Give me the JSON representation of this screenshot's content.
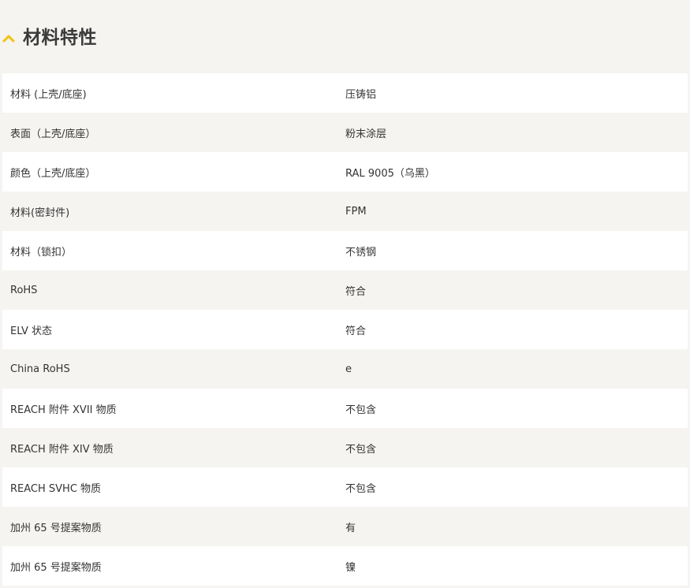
{
  "section": {
    "title": "材料特性",
    "toggle_icon": "chevron-up-icon",
    "accent_color": "#f2c51e"
  },
  "rows": [
    {
      "label": "材料 (上壳/底座)",
      "value": "压铸铝"
    },
    {
      "label": "表面（上壳/底座）",
      "value": "粉末涂层"
    },
    {
      "label": "颜色（上壳/底座）",
      "value": "RAL 9005（乌黑）"
    },
    {
      "label": "材料(密封件)",
      "value": "FPM"
    },
    {
      "label": "材料（锁扣）",
      "value": "不锈钢"
    },
    {
      "label": "RoHS",
      "value": "符合"
    },
    {
      "label": "ELV 状态",
      "value": "符合"
    },
    {
      "label": "China RoHS",
      "value": "e"
    },
    {
      "label": "REACH 附件 XVII 物质",
      "value": "不包含"
    },
    {
      "label": "REACH 附件 XIV 物质",
      "value": "不包含"
    },
    {
      "label": "REACH SVHC 物质",
      "value": "不包含"
    },
    {
      "label": "加州 65 号提案物质",
      "value": "有"
    },
    {
      "label": "加州 65 号提案物质",
      "value": "镍"
    }
  ]
}
